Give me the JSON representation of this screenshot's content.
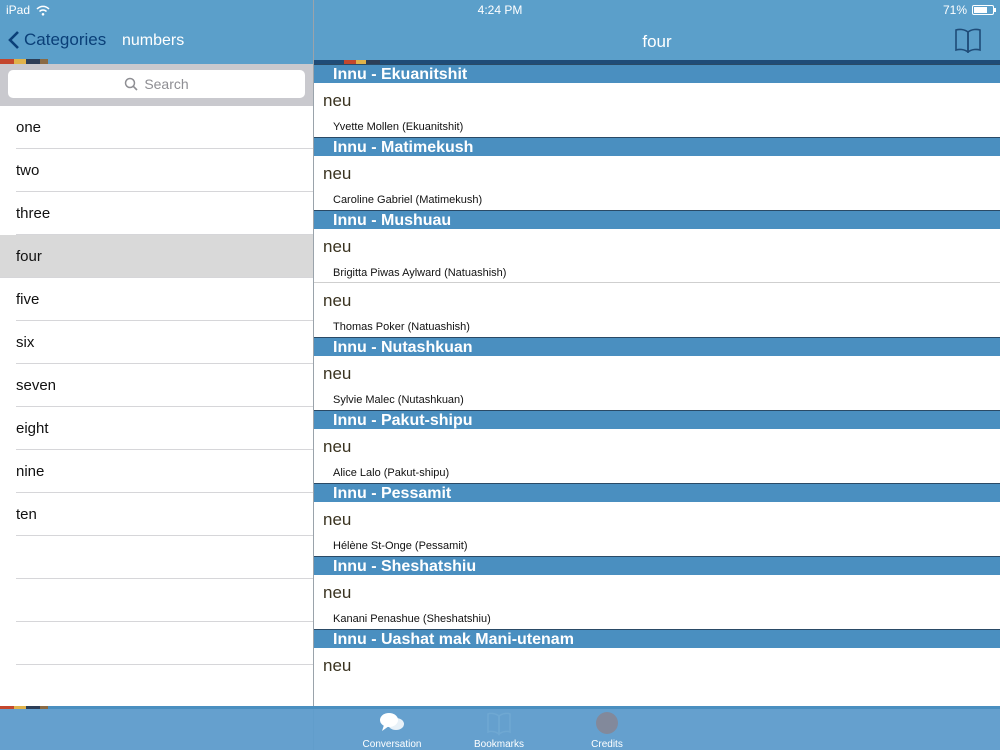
{
  "status_bar": {
    "device": "iPad",
    "time": "4:24 PM",
    "battery_percent": "71%",
    "battery_level": 0.71
  },
  "left": {
    "back_label": "Categories",
    "title": "numbers",
    "search_placeholder": "Search",
    "items": [
      {
        "label": "one"
      },
      {
        "label": "two"
      },
      {
        "label": "three"
      },
      {
        "label": "four",
        "selected": true
      },
      {
        "label": "five"
      },
      {
        "label": "six"
      },
      {
        "label": "seven"
      },
      {
        "label": "eight"
      },
      {
        "label": "nine"
      },
      {
        "label": "ten"
      }
    ]
  },
  "right": {
    "title": "four",
    "sections": [
      {
        "header": "Innu - Ekuanitshit",
        "entries": [
          {
            "word": "neu",
            "speaker": "Yvette Mollen (Ekuanitshit)"
          }
        ]
      },
      {
        "header": "Innu - Matimekush",
        "entries": [
          {
            "word": "neu",
            "speaker": "Caroline Gabriel (Matimekush)"
          }
        ]
      },
      {
        "header": "Innu - Mushuau",
        "entries": [
          {
            "word": "neu",
            "speaker": "Brigitta Piwas Aylward (Natuashish)"
          },
          {
            "word": "neu",
            "speaker": "Thomas Poker (Natuashish)"
          }
        ]
      },
      {
        "header": "Innu - Nutashkuan",
        "entries": [
          {
            "word": "neu",
            "speaker": "Sylvie Malec (Nutashkuan)"
          }
        ]
      },
      {
        "header": "Innu - Pakut-shipu",
        "entries": [
          {
            "word": "neu",
            "speaker": "Alice Lalo (Pakut-shipu)"
          }
        ]
      },
      {
        "header": "Innu - Pessamit",
        "entries": [
          {
            "word": "neu",
            "speaker": "Hélène St-Onge (Pessamit)"
          }
        ]
      },
      {
        "header": "Innu - Sheshatshiu",
        "entries": [
          {
            "word": "neu",
            "speaker": "Kanani Penashue (Sheshatshiu)"
          }
        ]
      },
      {
        "header": "Innu - Uashat mak Mani-utenam",
        "entries": [
          {
            "word": "neu",
            "speaker": ""
          }
        ]
      }
    ]
  },
  "tab_bar": {
    "tabs": [
      {
        "label": "Conversation",
        "icon": "speech-bubbles-icon"
      },
      {
        "label": "Bookmarks",
        "icon": "book-icon"
      },
      {
        "label": "Credits",
        "icon": "info-icon"
      }
    ]
  }
}
